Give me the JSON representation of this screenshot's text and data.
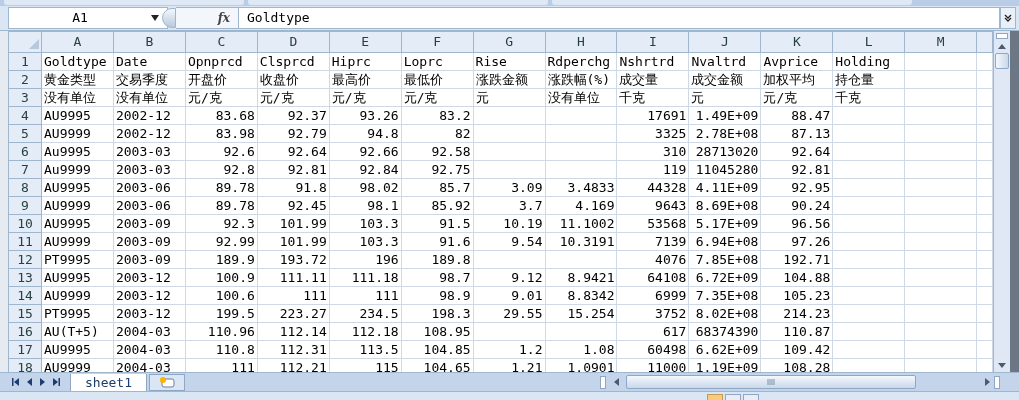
{
  "name_box": "A1",
  "function_button": "fx",
  "formula": "Goldtype",
  "columns": [
    {
      "label": "A",
      "kind": "text"
    },
    {
      "label": "B",
      "kind": "text"
    },
    {
      "label": "C",
      "kind": "number"
    },
    {
      "label": "D",
      "kind": "number"
    },
    {
      "label": "E",
      "kind": "number"
    },
    {
      "label": "F",
      "kind": "number"
    },
    {
      "label": "G",
      "kind": "number"
    },
    {
      "label": "H",
      "kind": "number"
    },
    {
      "label": "I",
      "kind": "number"
    },
    {
      "label": "J",
      "kind": "number"
    },
    {
      "label": "K",
      "kind": "number"
    },
    {
      "label": "L",
      "kind": "number"
    },
    {
      "label": "M",
      "kind": "number"
    }
  ],
  "rows": [
    {
      "number": "1",
      "kind": "header",
      "cells": [
        "Goldtype",
        "Date",
        "Opnprcd",
        "Clsprcd",
        "Hiprc",
        "Loprc",
        "Rise",
        "Rdperchg",
        "Nshrtrd",
        "Nvaltrd",
        "Avprice",
        "Holding",
        null
      ]
    },
    {
      "number": "2",
      "kind": "header",
      "cells": [
        "黄金类型",
        "交易季度",
        "开盘价",
        "收盘价",
        "最高价",
        "最低价",
        "涨跌金额",
        "涨跌幅(%)",
        "成交量",
        "成交金额",
        "加权平均",
        "持仓量",
        null
      ]
    },
    {
      "number": "3",
      "kind": "header",
      "cells": [
        "没有单位",
        "没有单位",
        "元/克",
        "元/克",
        "元/克",
        "元/克",
        "元",
        "没有单位",
        "千克",
        "元",
        "元/克",
        "千克",
        null
      ]
    },
    {
      "number": "4",
      "kind": "data",
      "cells": [
        "AU9995",
        "2002-12",
        "83.68",
        "92.37",
        "93.26",
        "83.2",
        null,
        null,
        "17691",
        "1.49E+09",
        "88.47",
        null,
        null
      ]
    },
    {
      "number": "5",
      "kind": "data",
      "cells": [
        "AU9999",
        "2002-12",
        "83.98",
        "92.79",
        "94.8",
        "82",
        null,
        null,
        "3325",
        "2.78E+08",
        "87.13",
        null,
        null
      ]
    },
    {
      "number": "6",
      "kind": "data",
      "cells": [
        "Au9995",
        "2003-03",
        "92.6",
        "92.64",
        "92.66",
        "92.58",
        null,
        null,
        "310",
        "28713020",
        "92.64",
        null,
        null
      ]
    },
    {
      "number": "7",
      "kind": "data",
      "cells": [
        "Au9999",
        "2003-03",
        "92.8",
        "92.81",
        "92.84",
        "92.75",
        null,
        null,
        "119",
        "11045280",
        "92.81",
        null,
        null
      ]
    },
    {
      "number": "8",
      "kind": "data",
      "cells": [
        "AU9995",
        "2003-06",
        "89.78",
        "91.8",
        "98.02",
        "85.7",
        "3.09",
        "3.4833",
        "44328",
        "4.11E+09",
        "92.95",
        null,
        null
      ]
    },
    {
      "number": "9",
      "kind": "data",
      "cells": [
        "AU9999",
        "2003-06",
        "89.78",
        "92.45",
        "98.1",
        "85.92",
        "3.7",
        "4.169",
        "9643",
        "8.69E+08",
        "90.24",
        null,
        null
      ]
    },
    {
      "number": "10",
      "kind": "data",
      "cells": [
        "AU9995",
        "2003-09",
        "92.3",
        "101.99",
        "103.3",
        "91.5",
        "10.19",
        "11.1002",
        "53568",
        "5.17E+09",
        "96.56",
        null,
        null
      ]
    },
    {
      "number": "11",
      "kind": "data",
      "cells": [
        "AU9999",
        "2003-09",
        "92.99",
        "101.99",
        "103.3",
        "91.6",
        "9.54",
        "10.3191",
        "7139",
        "6.94E+08",
        "97.26",
        null,
        null
      ]
    },
    {
      "number": "12",
      "kind": "data",
      "cells": [
        "PT9995",
        "2003-09",
        "189.9",
        "193.72",
        "196",
        "189.8",
        null,
        null,
        "4076",
        "7.85E+08",
        "192.71",
        null,
        null
      ]
    },
    {
      "number": "13",
      "kind": "data",
      "cells": [
        "AU9995",
        "2003-12",
        "100.9",
        "111.11",
        "111.18",
        "98.7",
        "9.12",
        "8.9421",
        "64108",
        "6.72E+09",
        "104.88",
        null,
        null
      ]
    },
    {
      "number": "14",
      "kind": "data",
      "cells": [
        "AU9999",
        "2003-12",
        "100.6",
        "111",
        "111",
        "98.9",
        "9.01",
        "8.8342",
        "6999",
        "7.35E+08",
        "105.23",
        null,
        null
      ]
    },
    {
      "number": "15",
      "kind": "data",
      "cells": [
        "PT9995",
        "2003-12",
        "199.5",
        "223.27",
        "234.5",
        "198.3",
        "29.55",
        "15.254",
        "3752",
        "8.02E+08",
        "214.23",
        null,
        null
      ]
    },
    {
      "number": "16",
      "kind": "data",
      "cells": [
        "AU(T+5)",
        "2004-03",
        "110.96",
        "112.14",
        "112.18",
        "108.95",
        null,
        null,
        "617",
        "68374390",
        "110.87",
        null,
        null
      ]
    },
    {
      "number": "17",
      "kind": "data",
      "cells": [
        "AU9995",
        "2004-03",
        "110.8",
        "112.31",
        "113.5",
        "104.85",
        "1.2",
        "1.08",
        "60498",
        "6.62E+09",
        "109.42",
        null,
        null
      ]
    },
    {
      "number": "18",
      "kind": "data",
      "cells": [
        "AU9999",
        "2004-03",
        "111",
        "112.21",
        "115",
        "104.65",
        "1.21",
        "1.0901",
        "11000",
        "1.19E+09",
        "108.28",
        null,
        null
      ]
    }
  ],
  "sheet_tabs": [
    {
      "label": "sheet1",
      "selected": true
    }
  ]
}
